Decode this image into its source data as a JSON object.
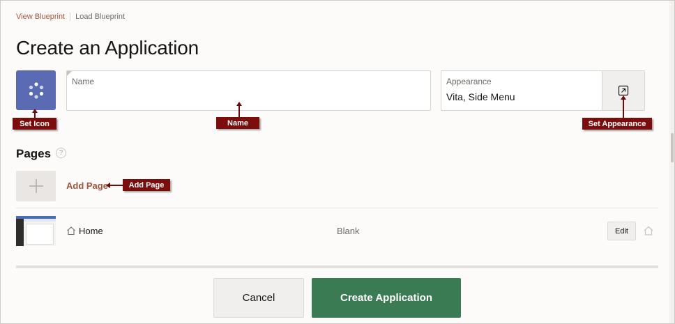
{
  "breadcrumb": {
    "view_blueprint": "View Blueprint",
    "load_blueprint": "Load Blueprint"
  },
  "page_title": "Create an Application",
  "name_field": {
    "label": "Name",
    "value": "",
    "placeholder": ""
  },
  "appearance": {
    "label": "Appearance",
    "value": "Vita, Side Menu"
  },
  "callouts": {
    "set_icon": "Set Icon",
    "name": "Name",
    "set_appearance": "Set Appearance",
    "add_page": "Add Page"
  },
  "pages_section": {
    "title": "Pages",
    "help": "?",
    "add_page_label": "Add Page",
    "rows": [
      {
        "name": "Home",
        "type": "Blank",
        "edit_label": "Edit"
      }
    ]
  },
  "footer": {
    "cancel_label": "Cancel",
    "create_label": "Create Application"
  },
  "icons": {
    "app_icon": "dots-circle-icon",
    "appearance_button": "external-link-icon",
    "add_page": "plus-icon",
    "page_home": "home-icon",
    "home_toggle": "home-outline-icon",
    "help": "help-circle-icon"
  },
  "colors": {
    "app_icon_bg": "#5a6bb4",
    "link": "#a2553a",
    "primary_button": "#3a7b54",
    "callout": "#7b0d0d"
  }
}
